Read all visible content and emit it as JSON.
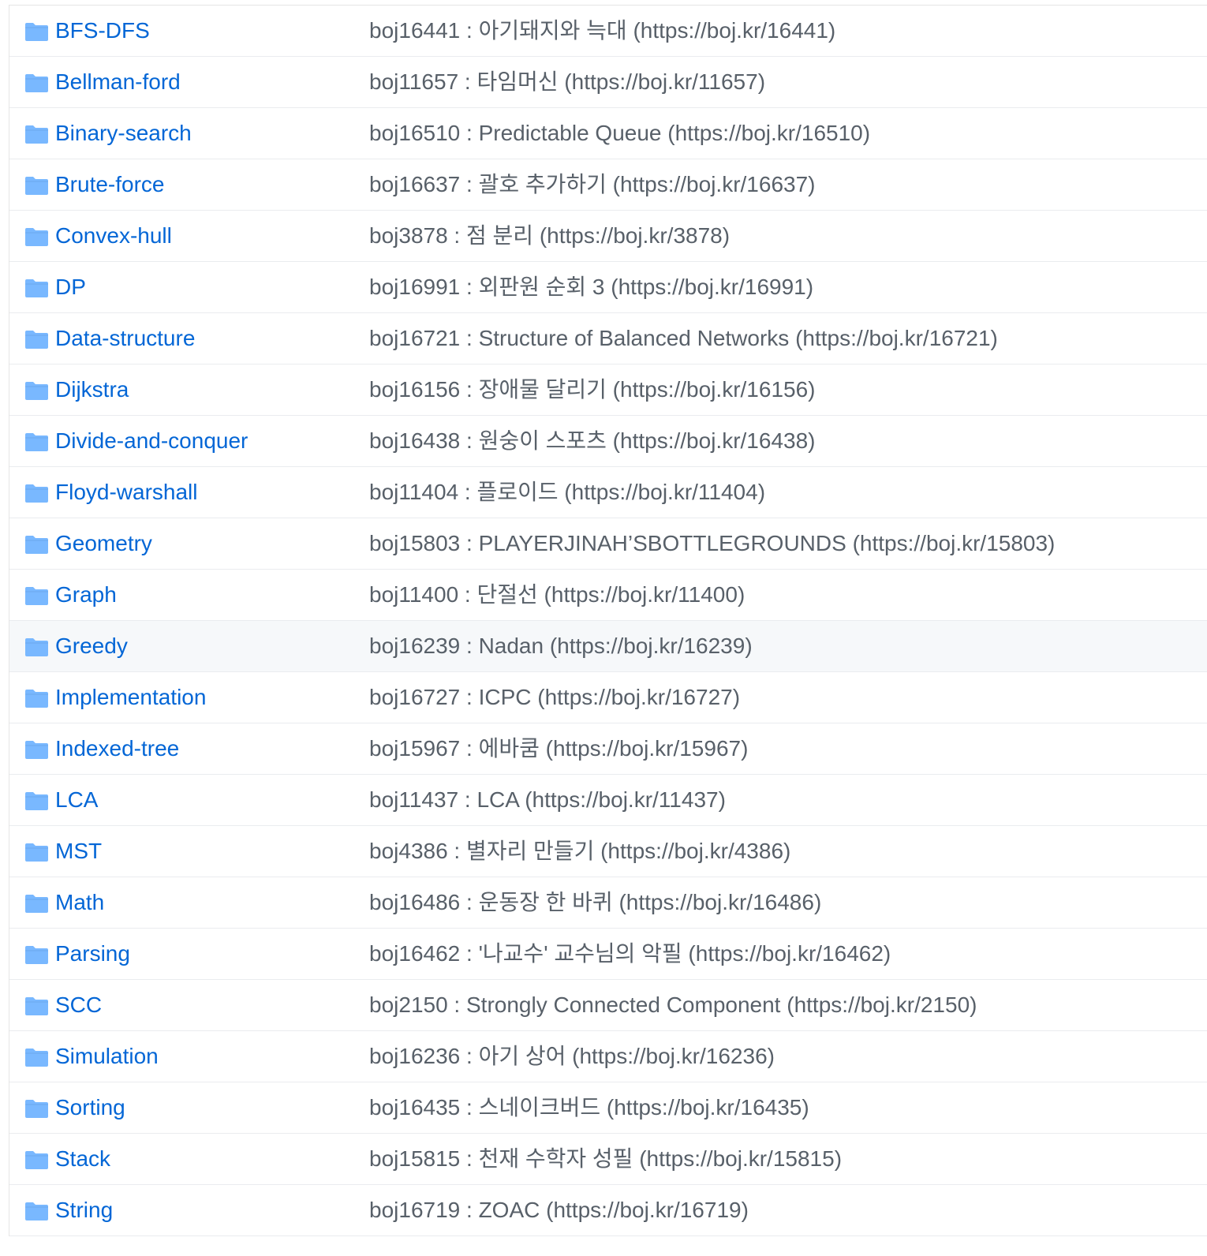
{
  "colors": {
    "link": "#0366d6",
    "commit_message": "#586069",
    "folder_icon": "#79b8ff",
    "row_border": "#eaecef",
    "hover_row_bg": "#f6f8fa"
  },
  "icons": {
    "folder": "folder-icon"
  },
  "files": [
    {
      "name": "BFS-DFS",
      "message": "boj16441 : 아기돼지와 늑대 (https://boj.kr/16441)"
    },
    {
      "name": "Bellman-ford",
      "message": "boj11657 : 타임머신 (https://boj.kr/11657)"
    },
    {
      "name": "Binary-search",
      "message": "boj16510 : Predictable Queue (https://boj.kr/16510)"
    },
    {
      "name": "Brute-force",
      "message": "boj16637 : 괄호 추가하기 (https://boj.kr/16637)"
    },
    {
      "name": "Convex-hull",
      "message": "boj3878 : 점 분리 (https://boj.kr/3878)"
    },
    {
      "name": "DP",
      "message": "boj16991 : 외판원 순회 3 (https://boj.kr/16991)"
    },
    {
      "name": "Data-structure",
      "message": "boj16721 : Structure of Balanced Networks (https://boj.kr/16721)"
    },
    {
      "name": "Dijkstra",
      "message": "boj16156 : 장애물 달리기 (https://boj.kr/16156)"
    },
    {
      "name": "Divide-and-conquer",
      "message": "boj16438 : 원숭이 스포츠 (https://boj.kr/16438)"
    },
    {
      "name": "Floyd-warshall",
      "message": "boj11404 : 플로이드 (https://boj.kr/11404)"
    },
    {
      "name": "Geometry",
      "message": "boj15803 : PLAYERJINAH’SBOTTLEGROUNDS (https://boj.kr/15803)"
    },
    {
      "name": "Graph",
      "message": "boj11400 : 단절선 (https://boj.kr/11400)"
    },
    {
      "name": "Greedy",
      "message": "boj16239 : Nadan (https://boj.kr/16239)",
      "hover": true
    },
    {
      "name": "Implementation",
      "message": "boj16727 : ICPC (https://boj.kr/16727)"
    },
    {
      "name": "Indexed-tree",
      "message": "boj15967 : 에바쿰 (https://boj.kr/15967)"
    },
    {
      "name": "LCA",
      "message": "boj11437 : LCA (https://boj.kr/11437)"
    },
    {
      "name": "MST",
      "message": "boj4386 : 별자리 만들기 (https://boj.kr/4386)"
    },
    {
      "name": "Math",
      "message": "boj16486 : 운동장 한 바퀴 (https://boj.kr/16486)"
    },
    {
      "name": "Parsing",
      "message": "boj16462 : '나교수' 교수님의 악필 (https://boj.kr/16462)"
    },
    {
      "name": "SCC",
      "message": "boj2150 : Strongly Connected Component (https://boj.kr/2150)"
    },
    {
      "name": "Simulation",
      "message": "boj16236 : 아기 상어 (https://boj.kr/16236)"
    },
    {
      "name": "Sorting",
      "message": "boj16435 : 스네이크버드 (https://boj.kr/16435)"
    },
    {
      "name": "Stack",
      "message": "boj15815 : 천재 수학자 성필 (https://boj.kr/15815)"
    },
    {
      "name": "String",
      "message": "boj16719 : ZOAC (https://boj.kr/16719)"
    }
  ]
}
